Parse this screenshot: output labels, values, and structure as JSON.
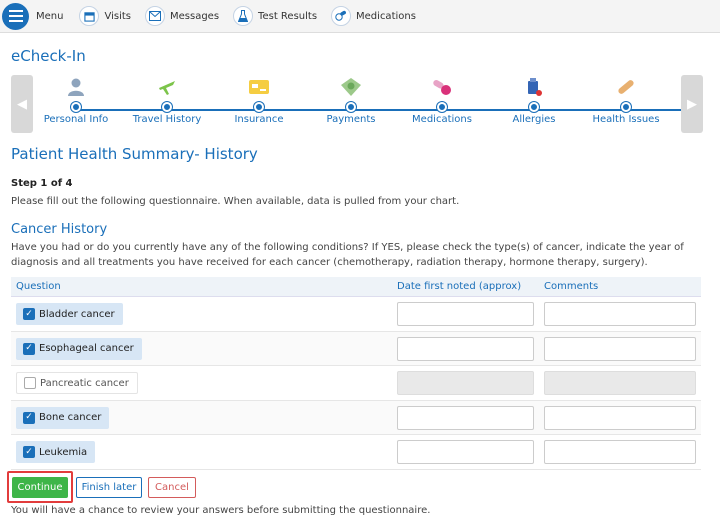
{
  "topnav": {
    "menu_label": "Menu",
    "items": [
      {
        "label": "Visits",
        "icon": "calendar-icon"
      },
      {
        "label": "Messages",
        "icon": "envelope-icon"
      },
      {
        "label": "Test Results",
        "icon": "flask-icon"
      },
      {
        "label": "Medications",
        "icon": "pills-icon"
      }
    ]
  },
  "page_title": "eCheck-In",
  "stepper": {
    "steps": [
      {
        "label": "Personal Info",
        "icon": "person-icon"
      },
      {
        "label": "Travel History",
        "icon": "airplane-icon"
      },
      {
        "label": "Insurance",
        "icon": "card-icon"
      },
      {
        "label": "Payments",
        "icon": "money-icon"
      },
      {
        "label": "Medications",
        "icon": "pills-icon"
      },
      {
        "label": "Allergies",
        "icon": "allergy-icon"
      },
      {
        "label": "Health Issues",
        "icon": "bandage-icon"
      }
    ],
    "prev_arrow": "◀",
    "next_arrow": "▶"
  },
  "section": {
    "title": "Patient Health Summary- History",
    "step_count": "Step 1 of 4",
    "instructions": "Please fill out the following questionnaire. When available, data is pulled from your chart.",
    "sub_title": "Cancer History",
    "description": "Have you had or do you currently have any of the following conditions? If YES, please check the type(s) of cancer, indicate the year of diagnosis and all treatments you have received for each cancer (chemotherapy, radiation therapy, hormone therapy, surgery)."
  },
  "table": {
    "headers": {
      "question": "Question",
      "date": "Date first noted (approx)",
      "comments": "Comments"
    },
    "rows": [
      {
        "label": "Bladder cancer",
        "checked": true,
        "date": "",
        "comments": ""
      },
      {
        "label": "Esophageal cancer",
        "checked": true,
        "date": "",
        "comments": ""
      },
      {
        "label": "Pancreatic cancer",
        "checked": false,
        "date": "",
        "comments": ""
      },
      {
        "label": "Bone cancer",
        "checked": true,
        "date": "",
        "comments": ""
      },
      {
        "label": "Leukemia",
        "checked": true,
        "date": "",
        "comments": ""
      }
    ]
  },
  "buttons": {
    "continue": "Continue",
    "finish_later": "Finish later",
    "cancel": "Cancel"
  },
  "footer_note": "You will have a chance to review your answers before submitting the questionnaire.",
  "colors": {
    "primary": "#1a6fb9",
    "continue": "#3eb548",
    "cancel": "#d35b5b",
    "highlight": "#e23c3c"
  }
}
